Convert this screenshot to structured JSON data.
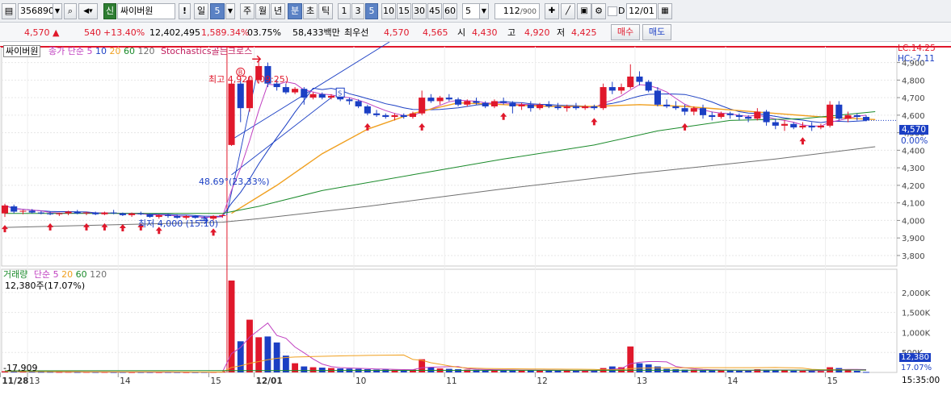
{
  "toolbar": {
    "code": "356890",
    "market_badge": "신",
    "stock_name": "싸이버원",
    "periods": [
      "일",
      "5",
      "주",
      "월",
      "년",
      "분",
      "초",
      "틱"
    ],
    "period_selected": "분",
    "minute_buttons": [
      "1",
      "3",
      "5",
      "10",
      "15",
      "30",
      "45",
      "60"
    ],
    "minute_selected": "5",
    "interval": "5",
    "count": "112",
    "count_total": "/900",
    "date": "12/01",
    "checkbox_label": "D"
  },
  "quote": {
    "price": "4,570",
    "change": "540",
    "change_pct": "+13.40%",
    "volume": "12,402,495",
    "volume_ratio": "1,589.34%",
    "turnover": "03.75%",
    "amount": "58,433백만",
    "best_ask_label": "최우선",
    "best_ask": "4,570",
    "best_bid": "4,565",
    "open_label": "시",
    "open": "4,430",
    "high_label": "고",
    "high": "4,920",
    "low_label": "저",
    "low": "4,425",
    "buy_label": "매수",
    "sell_label": "매도"
  },
  "colors": {
    "up": "#e0182b",
    "down": "#1b3fc4",
    "ma5": "#c040c0",
    "ma10": "#1b3fc4",
    "ma20": "#f0a020",
    "ma60": "#1a8a2a",
    "ma120": "#707070"
  },
  "price_panel": {
    "legend_name": "싸이버원",
    "legend_ma_label": "종가 단순",
    "legend_ma": [
      "5",
      "10",
      "20",
      "60",
      "120"
    ],
    "legend_indicator": "Stochastics골든크로스",
    "lc": "LC:14.25",
    "hc": "HC:-7.11",
    "high_annotation": "최고 4,920 (09:25)",
    "low_annotation": "최저 4,000 (15:10)",
    "angle_annotation": "48.69°(23.33%)",
    "current_price_tag": "4,570",
    "current_pct_tag": "0.00%"
  },
  "volume_panel": {
    "legend_name": "거래량",
    "legend_ma_label": "단순",
    "legend_ma": [
      "5",
      "20",
      "60",
      "120"
    ],
    "last_volume": "12,380주(17.07%)",
    "left_value": "-17,909",
    "current_volume_tag": "12,380",
    "current_volume_pct_tag": "17.07%"
  },
  "time_axis": {
    "time_tag": "15:35:00"
  },
  "chart_data": {
    "type": "candlestick",
    "interval": "5분",
    "y_ticks": [
      3800,
      3900,
      4000,
      4100,
      4200,
      4300,
      4400,
      4500,
      4600,
      4700,
      4800,
      4900
    ],
    "ylim": [
      3740,
      4990
    ],
    "x_labels": [
      {
        "i": 0,
        "label": "11/28",
        "bold": true
      },
      {
        "i": 3,
        "label": "13"
      },
      {
        "i": 13,
        "label": "14"
      },
      {
        "i": 23,
        "label": "15"
      },
      {
        "i": 28,
        "label": "12/01",
        "bold": true
      },
      {
        "i": 39,
        "label": "10"
      },
      {
        "i": 49,
        "label": "11"
      },
      {
        "i": 59,
        "label": "12"
      },
      {
        "i": 70,
        "label": "13"
      },
      {
        "i": 80,
        "label": "14"
      },
      {
        "i": 91,
        "label": "15"
      }
    ],
    "candles": [
      {
        "o": 4040,
        "h": 4095,
        "l": 4020,
        "c": 4085
      },
      {
        "o": 4080,
        "h": 4090,
        "l": 4040,
        "c": 4050
      },
      {
        "o": 4050,
        "h": 4060,
        "l": 4035,
        "c": 4055
      },
      {
        "o": 4055,
        "h": 4065,
        "l": 4040,
        "c": 4045
      },
      {
        "o": 4045,
        "h": 4055,
        "l": 4035,
        "c": 4040
      },
      {
        "o": 4040,
        "h": 4050,
        "l": 4030,
        "c": 4035
      },
      {
        "o": 4035,
        "h": 4045,
        "l": 4025,
        "c": 4040
      },
      {
        "o": 4040,
        "h": 4055,
        "l": 4030,
        "c": 4050
      },
      {
        "o": 4050,
        "h": 4060,
        "l": 4035,
        "c": 4040
      },
      {
        "o": 4040,
        "h": 4050,
        "l": 4030,
        "c": 4045
      },
      {
        "o": 4045,
        "h": 4050,
        "l": 4030,
        "c": 4035
      },
      {
        "o": 4035,
        "h": 4050,
        "l": 4030,
        "c": 4045
      },
      {
        "o": 4045,
        "h": 4060,
        "l": 4035,
        "c": 4040
      },
      {
        "o": 4040,
        "h": 4045,
        "l": 4025,
        "c": 4030
      },
      {
        "o": 4030,
        "h": 4045,
        "l": 4020,
        "c": 4040
      },
      {
        "o": 4040,
        "h": 4050,
        "l": 4030,
        "c": 4035
      },
      {
        "o": 4035,
        "h": 4040,
        "l": 4015,
        "c": 4020
      },
      {
        "o": 4020,
        "h": 4035,
        "l": 4010,
        "c": 4030
      },
      {
        "o": 4030,
        "h": 4040,
        "l": 4015,
        "c": 4025
      },
      {
        "o": 4025,
        "h": 4035,
        "l": 4010,
        "c": 4015
      },
      {
        "o": 4015,
        "h": 4030,
        "l": 4005,
        "c": 4025
      },
      {
        "o": 4025,
        "h": 4030,
        "l": 4010,
        "c": 4015
      },
      {
        "o": 4015,
        "h": 4025,
        "l": 4000,
        "c": 4010
      },
      {
        "o": 4010,
        "h": 4030,
        "l": 4000,
        "c": 4025
      },
      {
        "o": 4025,
        "h": 4035,
        "l": 4015,
        "c": 4030
      },
      {
        "o": 4430,
        "h": 4790,
        "l": 4425,
        "c": 4780
      },
      {
        "o": 4780,
        "h": 4800,
        "l": 4560,
        "c": 4640
      },
      {
        "o": 4640,
        "h": 4820,
        "l": 4620,
        "c": 4800
      },
      {
        "o": 4800,
        "h": 4920,
        "l": 4780,
        "c": 4880
      },
      {
        "o": 4880,
        "h": 4900,
        "l": 4760,
        "c": 4780
      },
      {
        "o": 4780,
        "h": 4800,
        "l": 4740,
        "c": 4760
      },
      {
        "o": 4760,
        "h": 4780,
        "l": 4720,
        "c": 4730
      },
      {
        "o": 4730,
        "h": 4760,
        "l": 4720,
        "c": 4750
      },
      {
        "o": 4750,
        "h": 4760,
        "l": 4660,
        "c": 4700
      },
      {
        "o": 4700,
        "h": 4730,
        "l": 4690,
        "c": 4720
      },
      {
        "o": 4720,
        "h": 4730,
        "l": 4690,
        "c": 4700
      },
      {
        "o": 4700,
        "h": 4720,
        "l": 4690,
        "c": 4710
      },
      {
        "o": 4710,
        "h": 4720,
        "l": 4680,
        "c": 4690
      },
      {
        "o": 4690,
        "h": 4700,
        "l": 4660,
        "c": 4680
      },
      {
        "o": 4680,
        "h": 4690,
        "l": 4640,
        "c": 4650
      },
      {
        "o": 4650,
        "h": 4660,
        "l": 4600,
        "c": 4610
      },
      {
        "o": 4610,
        "h": 4630,
        "l": 4590,
        "c": 4600
      },
      {
        "o": 4600,
        "h": 4610,
        "l": 4580,
        "c": 4590
      },
      {
        "o": 4590,
        "h": 4610,
        "l": 4570,
        "c": 4600
      },
      {
        "o": 4600,
        "h": 4610,
        "l": 4580,
        "c": 4590
      },
      {
        "o": 4590,
        "h": 4620,
        "l": 4580,
        "c": 4610
      },
      {
        "o": 4610,
        "h": 4740,
        "l": 4600,
        "c": 4700
      },
      {
        "o": 4700,
        "h": 4720,
        "l": 4670,
        "c": 4680
      },
      {
        "o": 4680,
        "h": 4710,
        "l": 4660,
        "c": 4700
      },
      {
        "o": 4700,
        "h": 4720,
        "l": 4680,
        "c": 4690
      },
      {
        "o": 4690,
        "h": 4700,
        "l": 4650,
        "c": 4660
      },
      {
        "o": 4660,
        "h": 4690,
        "l": 4650,
        "c": 4680
      },
      {
        "o": 4680,
        "h": 4700,
        "l": 4660,
        "c": 4670
      },
      {
        "o": 4670,
        "h": 4680,
        "l": 4640,
        "c": 4650
      },
      {
        "o": 4650,
        "h": 4690,
        "l": 4640,
        "c": 4680
      },
      {
        "o": 4680,
        "h": 4700,
        "l": 4660,
        "c": 4670
      },
      {
        "o": 4670,
        "h": 4680,
        "l": 4610,
        "c": 4650
      },
      {
        "o": 4650,
        "h": 4670,
        "l": 4630,
        "c": 4660
      },
      {
        "o": 4660,
        "h": 4680,
        "l": 4620,
        "c": 4640
      },
      {
        "o": 4640,
        "h": 4670,
        "l": 4630,
        "c": 4660
      },
      {
        "o": 4660,
        "h": 4680,
        "l": 4640,
        "c": 4650
      },
      {
        "o": 4650,
        "h": 4670,
        "l": 4630,
        "c": 4640
      },
      {
        "o": 4640,
        "h": 4660,
        "l": 4620,
        "c": 4650
      },
      {
        "o": 4650,
        "h": 4670,
        "l": 4630,
        "c": 4640
      },
      {
        "o": 4640,
        "h": 4660,
        "l": 4630,
        "c": 4650
      },
      {
        "o": 4650,
        "h": 4660,
        "l": 4630,
        "c": 4640
      },
      {
        "o": 4640,
        "h": 4780,
        "l": 4630,
        "c": 4760
      },
      {
        "o": 4760,
        "h": 4790,
        "l": 4720,
        "c": 4740
      },
      {
        "o": 4740,
        "h": 4780,
        "l": 4720,
        "c": 4760
      },
      {
        "o": 4760,
        "h": 4890,
        "l": 4750,
        "c": 4820
      },
      {
        "o": 4820,
        "h": 4850,
        "l": 4770,
        "c": 4790
      },
      {
        "o": 4790,
        "h": 4800,
        "l": 4730,
        "c": 4740
      },
      {
        "o": 4740,
        "h": 4760,
        "l": 4650,
        "c": 4660
      },
      {
        "o": 4660,
        "h": 4690,
        "l": 4640,
        "c": 4650
      },
      {
        "o": 4650,
        "h": 4680,
        "l": 4630,
        "c": 4640
      },
      {
        "o": 4640,
        "h": 4660,
        "l": 4600,
        "c": 4620
      },
      {
        "o": 4620,
        "h": 4650,
        "l": 4600,
        "c": 4640
      },
      {
        "o": 4640,
        "h": 4660,
        "l": 4580,
        "c": 4600
      },
      {
        "o": 4600,
        "h": 4620,
        "l": 4570,
        "c": 4590
      },
      {
        "o": 4590,
        "h": 4620,
        "l": 4580,
        "c": 4610
      },
      {
        "o": 4610,
        "h": 4620,
        "l": 4580,
        "c": 4600
      },
      {
        "o": 4600,
        "h": 4610,
        "l": 4570,
        "c": 4590
      },
      {
        "o": 4590,
        "h": 4600,
        "l": 4560,
        "c": 4580
      },
      {
        "o": 4580,
        "h": 4640,
        "l": 4570,
        "c": 4620
      },
      {
        "o": 4620,
        "h": 4630,
        "l": 4540,
        "c": 4560
      },
      {
        "o": 4560,
        "h": 4580,
        "l": 4520,
        "c": 4540
      },
      {
        "o": 4540,
        "h": 4570,
        "l": 4510,
        "c": 4550
      },
      {
        "o": 4550,
        "h": 4560,
        "l": 4520,
        "c": 4530
      },
      {
        "o": 4530,
        "h": 4560,
        "l": 4520,
        "c": 4540
      },
      {
        "o": 4540,
        "h": 4560,
        "l": 4510,
        "c": 4530
      },
      {
        "o": 4530,
        "h": 4550,
        "l": 4520,
        "c": 4540
      },
      {
        "o": 4540,
        "h": 4680,
        "l": 4530,
        "c": 4660
      },
      {
        "o": 4660,
        "h": 4680,
        "l": 4570,
        "c": 4580
      },
      {
        "o": 4580,
        "h": 4620,
        "l": 4560,
        "c": 4600
      },
      {
        "o": 4600,
        "h": 4610,
        "l": 4570,
        "c": 4590
      },
      {
        "o": 4590,
        "h": 4600,
        "l": 4565,
        "c": 4570
      }
    ],
    "ma": {
      "ma20": [
        [
          25,
          4040
        ],
        [
          30,
          4200
        ],
        [
          35,
          4380
        ],
        [
          40,
          4520
        ],
        [
          45,
          4610
        ],
        [
          50,
          4670
        ],
        [
          55,
          4660
        ],
        [
          60,
          4650
        ],
        [
          65,
          4650
        ],
        [
          70,
          4660
        ],
        [
          75,
          4650
        ],
        [
          80,
          4630
        ],
        [
          85,
          4610
        ],
        [
          90,
          4590
        ],
        [
          96,
          4575
        ]
      ],
      "ma60": [
        [
          0,
          4040
        ],
        [
          24,
          4040
        ],
        [
          28,
          4080
        ],
        [
          35,
          4170
        ],
        [
          45,
          4260
        ],
        [
          55,
          4350
        ],
        [
          65,
          4430
        ],
        [
          72,
          4510
        ],
        [
          80,
          4570
        ],
        [
          88,
          4580
        ],
        [
          96,
          4620
        ]
      ],
      "ma120": [
        [
          0,
          3960
        ],
        [
          24,
          3990
        ],
        [
          28,
          4010
        ],
        [
          40,
          4080
        ],
        [
          55,
          4180
        ],
        [
          70,
          4270
        ],
        [
          85,
          4350
        ],
        [
          96,
          4420
        ]
      ]
    },
    "arrows": [
      0,
      5,
      9,
      11,
      13,
      15,
      17,
      23,
      40,
      46,
      55,
      65,
      75,
      88
    ],
    "volumes_k": [
      30,
      25,
      20,
      18,
      15,
      15,
      12,
      14,
      10,
      12,
      10,
      11,
      9,
      10,
      8,
      9,
      8,
      7,
      9,
      8,
      7,
      8,
      10,
      12,
      18,
      2300,
      780,
      1320,
      880,
      900,
      750,
      420,
      230,
      150,
      130,
      120,
      110,
      100,
      95,
      90,
      80,
      70,
      75,
      65,
      60,
      70,
      330,
      130,
      100,
      90,
      80,
      70,
      65,
      60,
      70,
      60,
      55,
      50,
      60,
      55,
      50,
      45,
      50,
      45,
      40,
      45,
      110,
      150,
      130,
      650,
      230,
      200,
      150,
      90,
      80,
      70,
      70,
      60,
      55,
      50,
      50,
      45,
      45,
      80,
      70,
      60,
      50,
      45,
      40,
      40,
      35,
      130,
      110,
      60,
      40,
      12
    ],
    "vol_ticks_k": [
      500,
      1000,
      1500,
      2000
    ],
    "vol_ylim_k": [
      0,
      2300
    ]
  }
}
